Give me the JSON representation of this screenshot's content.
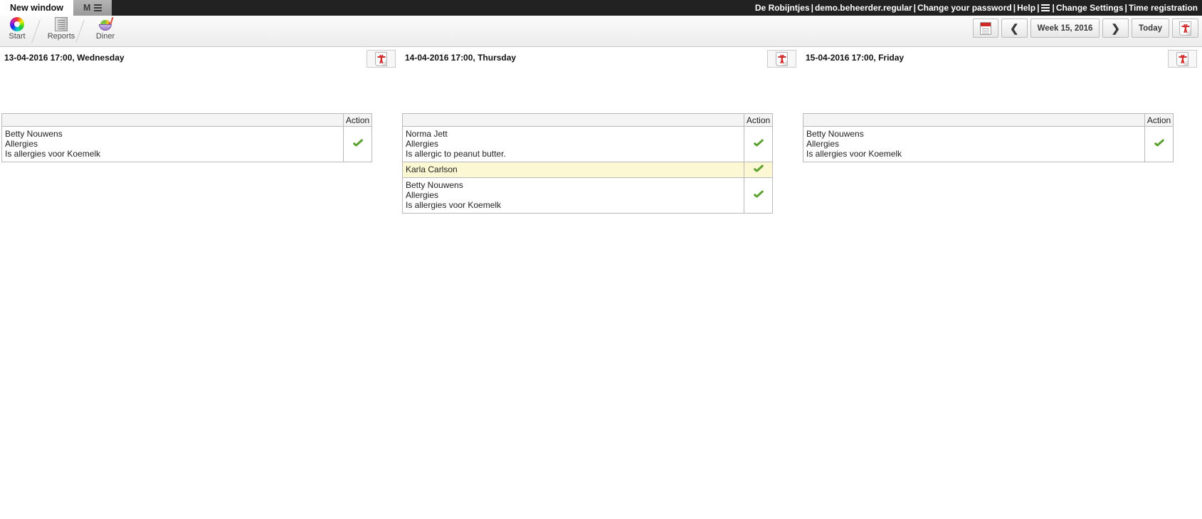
{
  "window": {
    "tabs": [
      {
        "label": "New window",
        "active": true
      },
      {
        "label": "M",
        "active": false,
        "icon": "hamburger-icon"
      }
    ]
  },
  "header": {
    "org": "De Robijntjes",
    "user": "demo.beheerder.regular",
    "links": [
      "Change your password",
      "Help",
      "Change Settings",
      "Time registration"
    ],
    "separator": "|",
    "menu_icon": "hamburger-icon"
  },
  "toolbar": {
    "items": [
      {
        "label": "Start",
        "icon": "start-icon"
      },
      {
        "label": "Reports",
        "icon": "reports-icon"
      },
      {
        "label": "Diner",
        "icon": "diner-icon"
      }
    ],
    "nav": {
      "calendar_icon": "calendar-icon",
      "prev_label": "❮",
      "period_label": "Week 15, 2016",
      "next_label": "❯",
      "today_label": "Today",
      "pdf_icon": "pdf-icon"
    }
  },
  "days": [
    {
      "title": "13-04-2016 17:00, Wednesday",
      "pdf_icon": "pdf-icon",
      "columns": [
        "",
        "Action"
      ],
      "rows": [
        {
          "lines": [
            "Betty Nouwens",
            "Allergies",
            "Is allergies voor Koemelk"
          ],
          "action_icon": "check-icon",
          "highlight": false
        }
      ]
    },
    {
      "title": "14-04-2016 17:00, Thursday",
      "pdf_icon": "pdf-icon",
      "columns": [
        "",
        "Action"
      ],
      "rows": [
        {
          "lines": [
            "Norma Jett",
            "Allergies",
            "Is allergic to peanut butter."
          ],
          "action_icon": "check-icon",
          "highlight": false
        },
        {
          "lines": [
            "Karla Carlson"
          ],
          "action_icon": "check-icon",
          "highlight": true
        },
        {
          "lines": [
            "Betty Nouwens",
            "Allergies",
            "Is allergies voor Koemelk"
          ],
          "action_icon": "check-icon",
          "highlight": false
        }
      ]
    },
    {
      "title": "15-04-2016 17:00, Friday",
      "pdf_icon": "pdf-icon",
      "columns": [
        "",
        "Action"
      ],
      "rows": [
        {
          "lines": [
            "Betty Nouwens",
            "Allergies",
            "Is allergies voor Koemelk"
          ],
          "action_icon": "check-icon",
          "highlight": false
        }
      ]
    }
  ],
  "colors": {
    "topbar_bg": "#222222",
    "highlight_row": "#fbf8d3",
    "check_green": "#5aa02c",
    "pdf_red": "#cf2a27"
  }
}
